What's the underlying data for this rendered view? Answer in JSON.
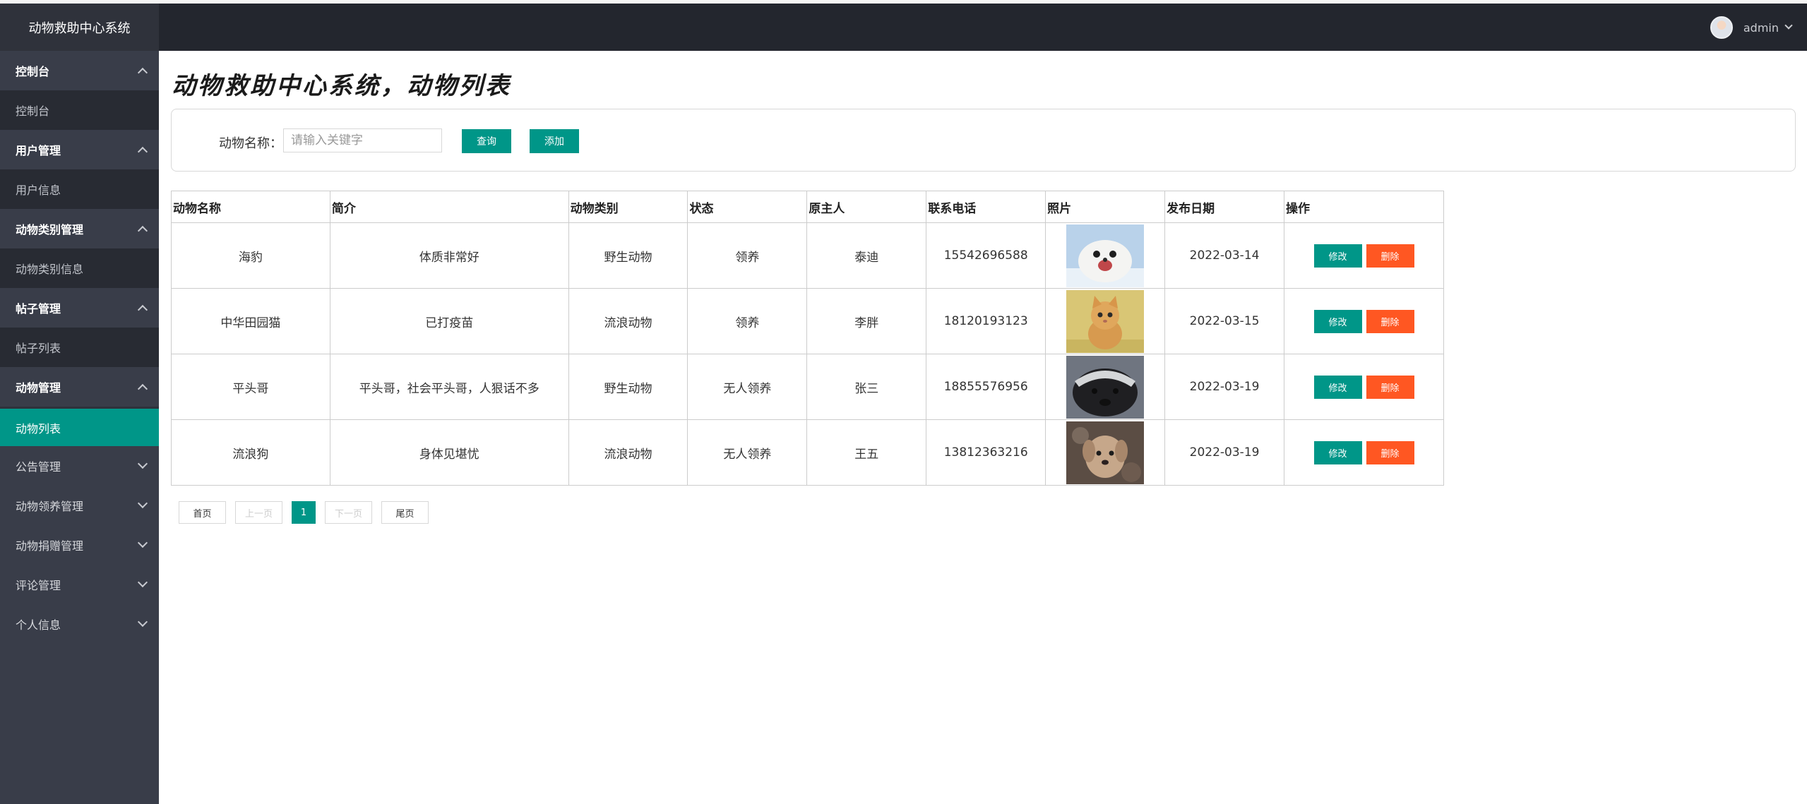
{
  "app": {
    "title": "动物救助中心系统"
  },
  "header": {
    "user_name": "admin"
  },
  "sidebar": {
    "groups": [
      {
        "title": "控制台",
        "expanded": true,
        "items": [
          "控制台"
        ]
      },
      {
        "title": "用户管理",
        "expanded": true,
        "items": [
          "用户信息"
        ]
      },
      {
        "title": "动物类别管理",
        "expanded": true,
        "items": [
          "动物类别信息"
        ]
      },
      {
        "title": "帖子管理",
        "expanded": true,
        "items": [
          "帖子列表"
        ]
      },
      {
        "title": "动物管理",
        "expanded": true,
        "items": [
          "动物列表"
        ]
      },
      {
        "title": "公告管理",
        "expanded": false,
        "items": []
      },
      {
        "title": "动物领养管理",
        "expanded": false,
        "items": []
      },
      {
        "title": "动物捐赠管理",
        "expanded": false,
        "items": []
      },
      {
        "title": "评论管理",
        "expanded": false,
        "items": []
      },
      {
        "title": "个人信息",
        "expanded": false,
        "items": []
      }
    ],
    "active_item": "动物列表"
  },
  "page": {
    "title": "动物救助中心系统，动物列表"
  },
  "search": {
    "label": "动物名称：",
    "placeholder": "请输入关键字",
    "value": "",
    "query_label": "查询",
    "add_label": "添加"
  },
  "table": {
    "columns": [
      "动物名称",
      "简介",
      "动物类别",
      "状态",
      "原主人",
      "联系电话",
      "照片",
      "发布日期",
      "操作"
    ],
    "rows": [
      {
        "name": "海豹",
        "intro": "体质非常好",
        "category": "野生动物",
        "status": "领养",
        "owner": "泰迪",
        "phone": "15542696588",
        "photo": "seal-photo",
        "date": "2022-03-14"
      },
      {
        "name": "中华田园猫",
        "intro": "已打疫苗",
        "category": "流浪动物",
        "status": "领养",
        "owner": "李胖",
        "phone": "18120193123",
        "photo": "kitten-photo",
        "date": "2022-03-15"
      },
      {
        "name": "平头哥",
        "intro": "平头哥，社会平头哥，人狠话不多",
        "category": "野生动物",
        "status": "无人领养",
        "owner": "张三",
        "phone": "18855576956",
        "photo": "honey-badger-photo",
        "date": "2022-03-19"
      },
      {
        "name": "流浪狗",
        "intro": "身体见堪忧",
        "category": "流浪动物",
        "status": "无人领养",
        "owner": "王五",
        "phone": "13812363216",
        "photo": "puppy-photo",
        "date": "2022-03-19"
      }
    ],
    "edit_label": "修改",
    "delete_label": "删除"
  },
  "pagination": {
    "first": "首页",
    "prev": "上一页",
    "current": "1",
    "next": "下一页",
    "last": "尾页"
  },
  "colors": {
    "accent": "#009688",
    "danger": "#ff5722",
    "sidebar": "#393d49",
    "header": "#23262e"
  }
}
